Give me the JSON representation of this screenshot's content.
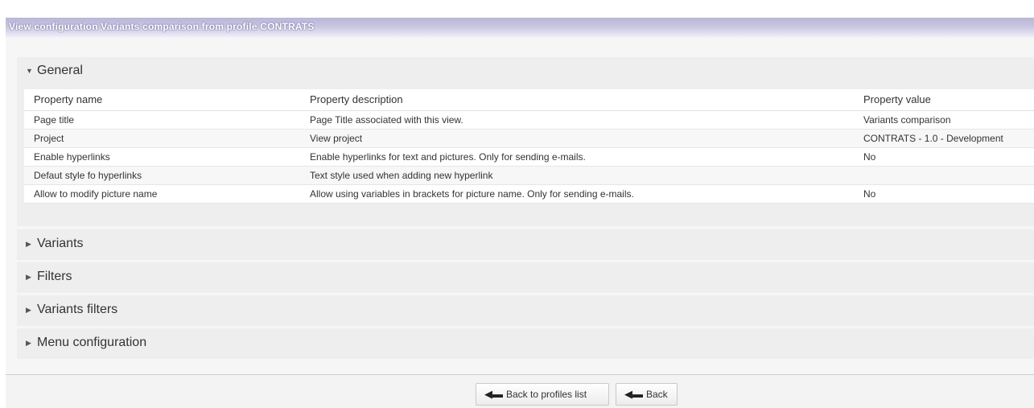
{
  "title_bar": "View configuration Variants comparison from profile CONTRATS",
  "sections": {
    "general": {
      "label": "General",
      "expanded": true,
      "columns": [
        "Property name",
        "Property description",
        "Property value"
      ],
      "rows": [
        [
          "Page title",
          "Page Title associated with this view.",
          "Variants comparison"
        ],
        [
          "Project",
          "View project",
          "CONTRATS - 1.0 - Development"
        ],
        [
          "Enable hyperlinks",
          "Enable hyperlinks for text and pictures. Only for sending e-mails.",
          "No"
        ],
        [
          "Defaut style fo hyperlinks",
          "Text style used when adding new hyperlink",
          ""
        ],
        [
          "Allow to modify picture name",
          "Allow using variables in brackets for picture name. Only for sending e-mails.",
          "No"
        ]
      ]
    },
    "variants": {
      "label": "Variants",
      "expanded": false
    },
    "filters": {
      "label": "Filters",
      "expanded": false
    },
    "variants_filters": {
      "label": "Variants filters",
      "expanded": false
    },
    "menu_configuration": {
      "label": "Menu configuration",
      "expanded": false
    }
  },
  "icons": {
    "expanded_caret": "caret-down-icon",
    "collapsed_caret": "caret-right-icon",
    "back_arrow": "arrow-left-icon"
  },
  "footer": {
    "back_to_profiles_label": "Back to profiles list",
    "back_label": "Back"
  },
  "colors": {
    "title_bar": "#c3c0de",
    "section_bg": "#eeeeee"
  }
}
